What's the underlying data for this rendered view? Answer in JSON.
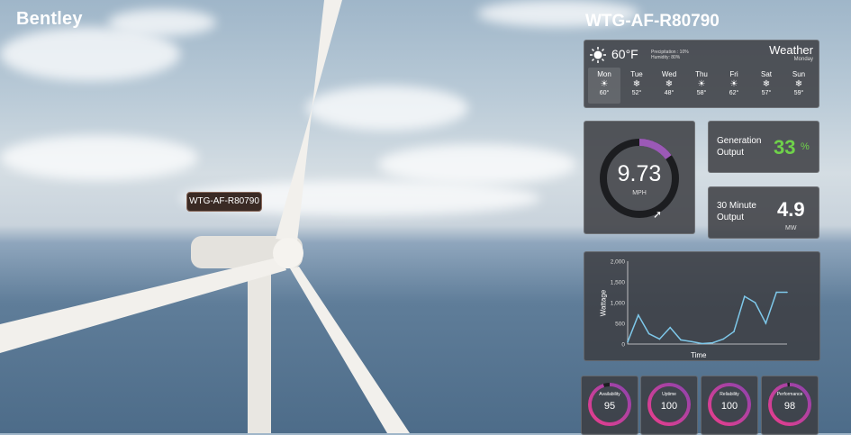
{
  "app": {
    "logo": "Bentley"
  },
  "turbine": {
    "tag_label": "WTG-AF-R80790",
    "title": "WTG-AF-R80790"
  },
  "weather": {
    "current_icon": "sun-icon",
    "current_temp": "60°F",
    "precipitation": "Precipitation : 10%",
    "humidity": "Humidity: 80%",
    "title": "Weather",
    "day": "Monday",
    "forecast": [
      {
        "day": "Mon",
        "icon": "sun-icon",
        "temp": "60°"
      },
      {
        "day": "Tue",
        "icon": "snow-icon",
        "temp": "52°"
      },
      {
        "day": "Wed",
        "icon": "snow-icon",
        "temp": "48°"
      },
      {
        "day": "Thu",
        "icon": "sun-icon",
        "temp": "58°"
      },
      {
        "day": "Fri",
        "icon": "sun-icon",
        "temp": "62°"
      },
      {
        "day": "Sat",
        "icon": "snow-icon",
        "temp": "57°"
      },
      {
        "day": "Sun",
        "icon": "snow-icon",
        "temp": "59°"
      }
    ]
  },
  "wind_speed": {
    "value": "9.73",
    "unit": "MPH",
    "gauge_fraction": 0.15
  },
  "generation_output": {
    "label_line1": "Generation",
    "label_line2": "Output",
    "value": "33",
    "unit": "%"
  },
  "thirty_min_output": {
    "label_line1": "30 Minute",
    "label_line2": "Output",
    "value": "4.9",
    "unit": "MW"
  },
  "chart_data": {
    "type": "line",
    "xlabel": "Time",
    "ylabel": "Wattage",
    "ylim": [
      0,
      2000
    ],
    "yticks": [
      "2,000",
      "1,500",
      "1,000",
      "500",
      "0"
    ],
    "x": [
      0,
      1,
      2,
      3,
      4,
      5,
      6,
      7,
      8,
      9,
      10,
      11,
      12,
      13,
      14,
      15
    ],
    "values": [
      50,
      700,
      250,
      120,
      400,
      100,
      60,
      10,
      30,
      120,
      300,
      1150,
      1000,
      500,
      1250,
      1250
    ],
    "grid": false,
    "line_color": "#7ec8ea"
  },
  "kpis": [
    {
      "label": "Availability",
      "value": "95",
      "fraction": 0.95
    },
    {
      "label": "Uptime",
      "value": "100",
      "fraction": 1.0
    },
    {
      "label": "Reliability",
      "value": "100",
      "fraction": 1.0
    },
    {
      "label": "Performance",
      "value": "98",
      "fraction": 0.98
    }
  ],
  "colors": {
    "accent_green": "#6fd24a",
    "gauge_arc": "#9b59b6",
    "kpi_arc_start": "#e83e8c",
    "kpi_arc_end": "#8e44ad"
  }
}
